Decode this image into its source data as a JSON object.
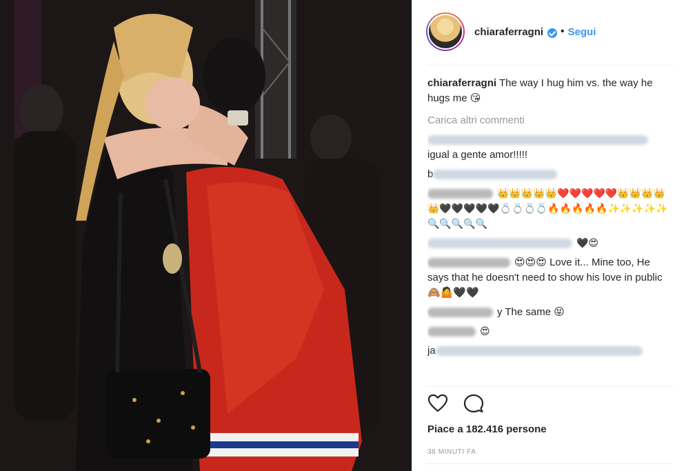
{
  "post": {
    "author": {
      "username": "chiaraferragni",
      "verified": true,
      "separator": "•",
      "follow_label": "Segui"
    },
    "caption": {
      "username": "chiaraferragni",
      "text": " The way I hug him vs. the way he hugs me 😘"
    },
    "load_more_label": "Carica altri commenti",
    "comments": [
      {
        "username_hidden": true,
        "text": "igual a gente amor!!!!!"
      },
      {
        "username_hidden": true,
        "prefix": "b",
        "text": ""
      },
      {
        "username_hidden": true,
        "text": "👑👑👑👑👑❤️❤️❤️❤️❤️👑👑👑👑👑🖤🖤🖤🖤🖤💍💍💍💍🔥🔥🔥🔥🔥✨✨✨✨✨🔍🔍🔍🔍🔍"
      },
      {
        "username_hidden": true,
        "text": "🖤😍"
      },
      {
        "username_hidden": true,
        "text": "😍😍😍 Love it... Mine too, He says that he doesn't need to show his love in public🙈🤷🖤🖤"
      },
      {
        "username_hidden": true,
        "text": "y The same 😝"
      },
      {
        "username_hidden": true,
        "text": "😍"
      },
      {
        "username_hidden": true,
        "prefix": "ja",
        "text": ""
      }
    ],
    "likes_text": "Piace a 182.416 persone",
    "time_text": "38 MINUTI FA"
  },
  "icons": {
    "like": "heart-icon",
    "comment": "comment-icon",
    "verified": "verified-badge-icon"
  },
  "colors": {
    "link": "#3897f0",
    "text": "#262626",
    "muted": "#999999",
    "jacket": "#c8281b"
  }
}
